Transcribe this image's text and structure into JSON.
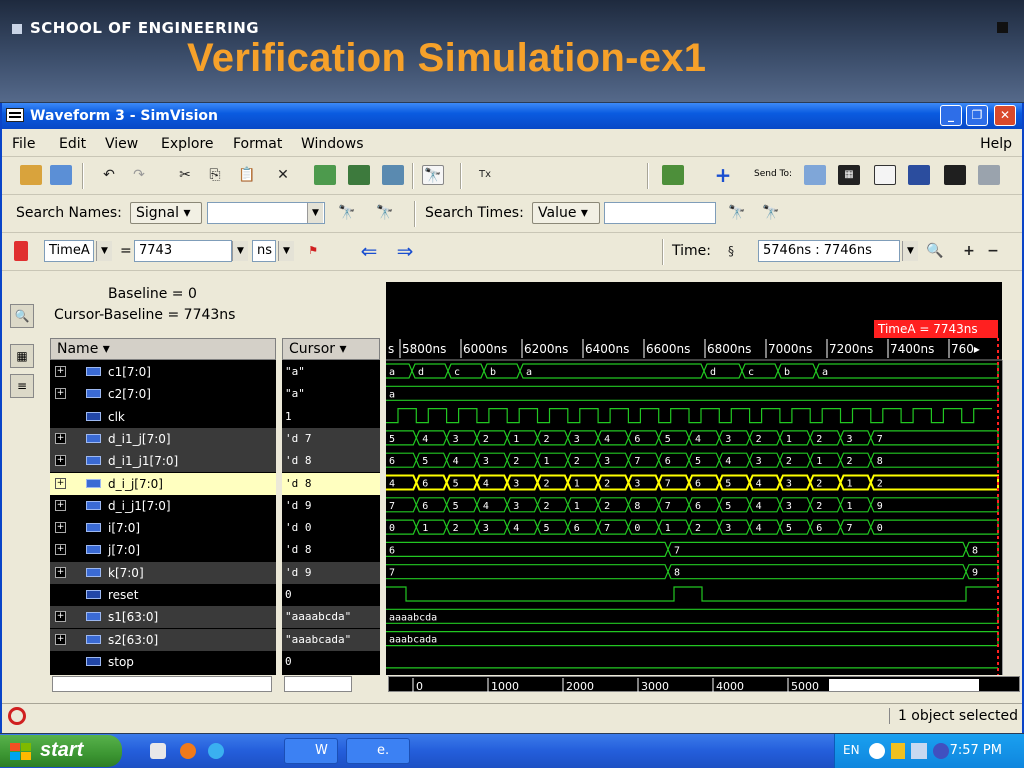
{
  "slide": {
    "school": "SCHOOL OF ENGINEERING",
    "title": "Verification Simulation-ex1"
  },
  "window": {
    "title": "Waveform 3 - SimVision"
  },
  "menu": {
    "items": [
      "File",
      "Edit",
      "View",
      "Explore",
      "Format",
      "Windows"
    ],
    "help": "Help"
  },
  "toolbar": {
    "send_to_label": "Send To:"
  },
  "search": {
    "names_label": "Search Names:",
    "names_mode": "Signal",
    "names_value": "",
    "times_label": "Search Times:",
    "times_mode": "Value",
    "times_value": ""
  },
  "cursorbar": {
    "cursor_name": "TimeA",
    "equals": "=",
    "cursor_value": "7743",
    "unit": "ns",
    "time_label": "Time:",
    "time_range": "5746ns : 7746ns"
  },
  "baseline": {
    "baseline_text": "Baseline = 0",
    "cursor_baseline_text": "Cursor-Baseline = 7743ns"
  },
  "columns": {
    "name_header": "Name",
    "cursor_header": "Cursor"
  },
  "signals": [
    {
      "name": "c1[7:0]",
      "cursor": "\"a\"",
      "kind": "bus"
    },
    {
      "name": "c2[7:0]",
      "cursor": "\"a\"",
      "kind": "bus"
    },
    {
      "name": "clk",
      "cursor": "1",
      "kind": "bit"
    },
    {
      "name": "d_i1_j[7:0]",
      "cursor": "'d 7",
      "kind": "bus"
    },
    {
      "name": "d_i1_j1[7:0]",
      "cursor": "'d 8",
      "kind": "bus"
    },
    {
      "name": "d_i_j[7:0]",
      "cursor": "'d 8",
      "kind": "bus"
    },
    {
      "name": "d_i_j1[7:0]",
      "cursor": "'d 9",
      "kind": "bus"
    },
    {
      "name": "i[7:0]",
      "cursor": "'d 0",
      "kind": "bus"
    },
    {
      "name": "j[7:0]",
      "cursor": "'d 8",
      "kind": "bus"
    },
    {
      "name": "k[7:0]",
      "cursor": "'d 9",
      "kind": "bus"
    },
    {
      "name": "reset",
      "cursor": "0",
      "kind": "bit"
    },
    {
      "name": "s1[63:0]",
      "cursor": "\"aaaabcda\"",
      "kind": "bus"
    },
    {
      "name": "s2[63:0]",
      "cursor": "\"aaabcada\"",
      "kind": "bus"
    },
    {
      "name": "stop",
      "cursor": "0",
      "kind": "bit"
    }
  ],
  "timeline": {
    "ticks": [
      "s",
      "5800ns",
      "6000ns",
      "6200ns",
      "6400ns",
      "6600ns",
      "6800ns",
      "7000ns",
      "7200ns",
      "7400ns",
      "760▸"
    ],
    "cursor_flag": "TimeA = 7743ns",
    "overview_ticks": [
      "0",
      "1000",
      "2000",
      "3000",
      "4000",
      "5000"
    ]
  },
  "waves": {
    "c1": [
      "a",
      "d",
      "c",
      "b",
      "a",
      "d",
      "c",
      "b",
      "a"
    ],
    "c2": [
      "a"
    ],
    "d_i1_j": [
      "5",
      "4",
      "3",
      "2",
      "1",
      "2",
      "3",
      "4",
      "6",
      "5",
      "4",
      "3",
      "2",
      "1",
      "2",
      "3",
      "7"
    ],
    "d_i1_j1": [
      "6",
      "5",
      "4",
      "3",
      "2",
      "1",
      "2",
      "3",
      "7",
      "6",
      "5",
      "4",
      "3",
      "2",
      "1",
      "2",
      "8"
    ],
    "d_i_j": [
      "4",
      "6",
      "5",
      "4",
      "3",
      "2",
      "1",
      "2",
      "3",
      "7",
      "6",
      "5",
      "4",
      "3",
      "2",
      "1",
      "2"
    ],
    "d_i_j1": [
      "7",
      "6",
      "5",
      "4",
      "3",
      "2",
      "1",
      "2",
      "8",
      "7",
      "6",
      "5",
      "4",
      "3",
      "2",
      "1",
      "9"
    ],
    "i": [
      "0",
      "1",
      "2",
      "3",
      "4",
      "5",
      "6",
      "7",
      "0",
      "1",
      "2",
      "3",
      "4",
      "5",
      "6",
      "7",
      "0"
    ],
    "j": [
      "6",
      "7",
      "8"
    ],
    "k": [
      "7",
      "8",
      "9"
    ],
    "s1": [
      "aaaabcda"
    ],
    "s2": [
      "aaabcada"
    ]
  },
  "status": {
    "text": "1 object selected"
  },
  "taskbar": {
    "start": "start",
    "task1": "W",
    "task2": "e.",
    "lang": "EN",
    "clock": "7:57 PM"
  },
  "colors": {
    "wave_green": "#22c722",
    "selected_yellow": "#ffff00",
    "cursor_red": "#ff2020",
    "title_orange": "#f6a12a"
  }
}
